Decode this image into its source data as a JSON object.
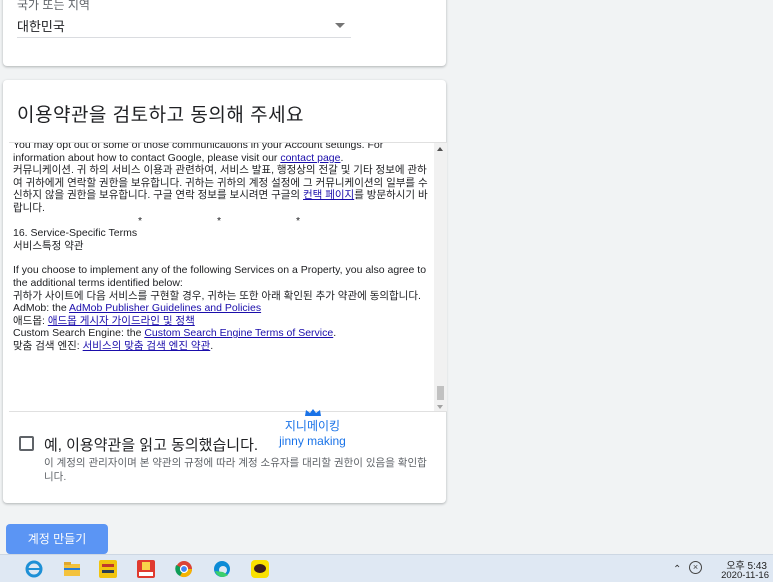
{
  "country": {
    "label": "국가 또는 지역",
    "value": "대한민국"
  },
  "terms": {
    "title": "이용약관을 검토하고 동의해 주세요",
    "p1_en_a": "You may opt out of some of those communications in your Account settings. For information about how to contact Google, please visit our ",
    "p1_en_link": "contact page",
    "p1_en_b": ".",
    "p1_ko_a": "커뮤니케이션. 귀 하의 서비스 이용과 관련하여, 서비스 발표, 행정상의 전갈 및 기타 정보에 관하여 귀하에게 연락할 권한을 보유합니다. 귀하는 귀하의 계정 설정에 그 커뮤니케이션의 일부를 수신하지 않을 권한을 보유합니다. 구글 연락 정보를 보시려면 구글의 ",
    "p1_ko_link": "컨택 페이지",
    "p1_ko_b": "를 방문하시기 바랍니다.",
    "stars": "* * *",
    "s16_en": "16. Service-Specific Terms",
    "s16_ko": "서비스특정 약관",
    "p2_en": "If you choose to implement any of the following Services on a Property, you also agree to the additional terms identified below:",
    "p2_ko": "귀하가 사이트에 다음 서비스를 구현할 경우, 귀하는 또한 아래 확인된 추가 약관에 동의합니다.",
    "admob_prefix": "AdMob: the ",
    "admob_link": "AdMob Publisher Guidelines and Policies",
    "admob_ko_prefix": "애드몹: ",
    "admob_ko_link": "애드몹 게시자 가이드라인 및 정책",
    "cse_prefix": "Custom Search Engine: the ",
    "cse_link": "Custom Search Engine Terms of Service",
    "cse_suffix": ".",
    "cse_ko_prefix": "맞춤 검색 엔진: ",
    "cse_ko_link": "서비스의 맞춤 검색 엔진 약관",
    "cse_ko_suffix": "."
  },
  "agree": {
    "label": "예, 이용약관을 읽고 동의했습니다.",
    "sub": "이 계정의 관리자이며 본 약관의 규정에 따라 계정 소유자를 대리할 권한이 있음을 확인합니다."
  },
  "watermark": {
    "line1": "지니메이킹",
    "line2": "jinny making"
  },
  "create_button": "계정 만들기",
  "taskbar": {
    "icons": [
      "internet-explorer-icon",
      "file-explorer-icon",
      "app-icon",
      "clip-icon",
      "chrome-icon",
      "edge-icon",
      "kakaotalk-icon"
    ],
    "time": "오후 5:43",
    "date": "2020-11-16"
  },
  "colors": {
    "accent": "#4285f4",
    "link": "#1a0dab",
    "watermark": "#1a73e8"
  }
}
